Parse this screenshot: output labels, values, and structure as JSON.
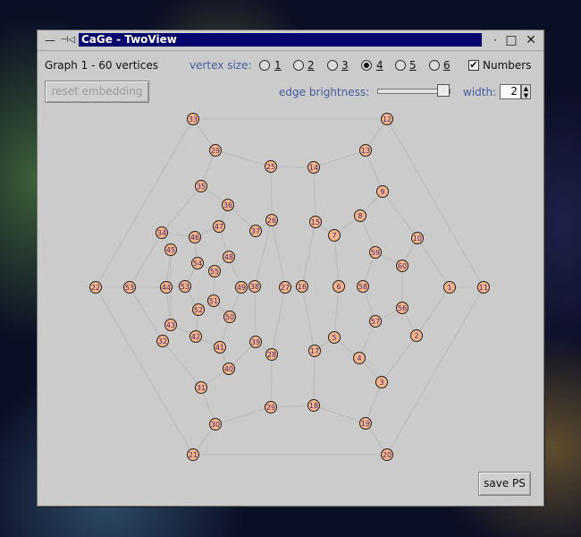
{
  "window": {
    "title": "CaGe - TwoView",
    "controls": {
      "minimize": "—",
      "pin": "⊣◁",
      "dot": "·",
      "maximize": "□",
      "close": "✕"
    }
  },
  "info": {
    "graph_label": "Graph 1 - 60 vertices"
  },
  "vertex_size": {
    "label": "vertex size:",
    "options": [
      "1",
      "2",
      "3",
      "4",
      "5",
      "6"
    ],
    "selected": "4"
  },
  "numbers": {
    "label": "Numbers",
    "checked": true,
    "check_glyph": "✔"
  },
  "reset_button": {
    "label": "reset embedding",
    "enabled": false
  },
  "edge_brightness": {
    "label": "edge brightness:",
    "level": 0.92
  },
  "width": {
    "label": "width:",
    "value": "2",
    "up": "▲",
    "down": "▼"
  },
  "save_button": {
    "label": "save PS"
  },
  "colors": {
    "vertex_fill": "#f7b489",
    "vertex_stroke": "#222222",
    "edge": "#bdbdbd",
    "label": "#3a2a7a",
    "title_bg": "#06066e"
  },
  "graph": {
    "vertices": [
      {
        "id": "33"
      },
      {
        "id": "12"
      },
      {
        "id": "29"
      },
      {
        "id": "13"
      },
      {
        "id": "25"
      },
      {
        "id": "14"
      },
      {
        "id": "35"
      },
      {
        "id": "9"
      },
      {
        "id": "36"
      },
      {
        "id": "26"
      },
      {
        "id": "15"
      },
      {
        "id": "8"
      },
      {
        "id": "47"
      },
      {
        "id": "37"
      },
      {
        "id": "7"
      },
      {
        "id": "34"
      },
      {
        "id": "46"
      },
      {
        "id": "10"
      },
      {
        "id": "45"
      },
      {
        "id": "48"
      },
      {
        "id": "59"
      },
      {
        "id": "54"
      },
      {
        "id": "60"
      },
      {
        "id": "55"
      },
      {
        "id": "22"
      },
      {
        "id": "53"
      },
      {
        "id": "44"
      },
      {
        "id": "53b",
        "label": "53"
      },
      {
        "id": "49"
      },
      {
        "id": "38"
      },
      {
        "id": "27"
      },
      {
        "id": "16"
      },
      {
        "id": "6"
      },
      {
        "id": "58"
      },
      {
        "id": "1"
      },
      {
        "id": "11"
      },
      {
        "id": "51"
      },
      {
        "id": "52"
      },
      {
        "id": "56"
      },
      {
        "id": "50"
      },
      {
        "id": "57"
      },
      {
        "id": "43"
      },
      {
        "id": "42"
      },
      {
        "id": "5"
      },
      {
        "id": "2"
      },
      {
        "id": "32"
      },
      {
        "id": "41"
      },
      {
        "id": "39"
      },
      {
        "id": "28"
      },
      {
        "id": "17"
      },
      {
        "id": "4"
      },
      {
        "id": "40"
      },
      {
        "id": "3"
      },
      {
        "id": "31"
      },
      {
        "id": "29b",
        "label": "29"
      },
      {
        "id": "18"
      },
      {
        "id": "30"
      },
      {
        "id": "19"
      },
      {
        "id": "21"
      },
      {
        "id": "20"
      }
    ],
    "edges": [
      [
        "33",
        "12"
      ],
      [
        "12",
        "11"
      ],
      [
        "11",
        "20"
      ],
      [
        "20",
        "21"
      ],
      [
        "21",
        "22"
      ],
      [
        "22",
        "33"
      ],
      [
        "33",
        "29"
      ],
      [
        "29",
        "25"
      ],
      [
        "25",
        "14"
      ],
      [
        "14",
        "13"
      ],
      [
        "13",
        "12"
      ],
      [
        "29",
        "35"
      ],
      [
        "35",
        "34"
      ],
      [
        "34",
        "45"
      ],
      [
        "45",
        "43"
      ],
      [
        "43",
        "32"
      ],
      [
        "32",
        "31"
      ],
      [
        "31",
        "30"
      ],
      [
        "30",
        "29b"
      ],
      [
        "29b",
        "18"
      ],
      [
        "18",
        "19"
      ],
      [
        "19",
        "3"
      ],
      [
        "3",
        "2"
      ],
      [
        "2",
        "1"
      ],
      [
        "1",
        "10"
      ],
      [
        "10",
        "9"
      ],
      [
        "9",
        "13"
      ],
      [
        "22",
        "53"
      ],
      [
        "53",
        "44"
      ],
      [
        "53",
        "34"
      ],
      [
        "53",
        "32"
      ],
      [
        "11",
        "1"
      ],
      [
        "21",
        "30"
      ],
      [
        "20",
        "19"
      ],
      [
        "25",
        "26"
      ],
      [
        "14",
        "15"
      ],
      [
        "26",
        "37"
      ],
      [
        "26",
        "38"
      ],
      [
        "15",
        "7"
      ],
      [
        "15",
        "16"
      ],
      [
        "35",
        "36"
      ],
      [
        "36",
        "37"
      ],
      [
        "36",
        "47"
      ],
      [
        "47",
        "46"
      ],
      [
        "46",
        "34"
      ],
      [
        "47",
        "48"
      ],
      [
        "9",
        "8"
      ],
      [
        "8",
        "7"
      ],
      [
        "8",
        "59"
      ],
      [
        "7",
        "6"
      ],
      [
        "59",
        "60"
      ],
      [
        "60",
        "10"
      ],
      [
        "60",
        "56"
      ],
      [
        "59",
        "58"
      ],
      [
        "58",
        "57"
      ],
      [
        "57",
        "56"
      ],
      [
        "56",
        "2"
      ],
      [
        "57",
        "4"
      ],
      [
        "4",
        "3"
      ],
      [
        "4",
        "5"
      ],
      [
        "5",
        "6"
      ],
      [
        "5",
        "17"
      ],
      [
        "17",
        "16"
      ],
      [
        "17",
        "18"
      ],
      [
        "16",
        "27"
      ],
      [
        "27",
        "28"
      ],
      [
        "27",
        "26"
      ],
      [
        "28",
        "29b"
      ],
      [
        "28",
        "39"
      ],
      [
        "39",
        "38"
      ],
      [
        "39",
        "40"
      ],
      [
        "40",
        "41"
      ],
      [
        "40",
        "31"
      ],
      [
        "41",
        "42"
      ],
      [
        "42",
        "43"
      ],
      [
        "41",
        "50"
      ],
      [
        "50",
        "51"
      ],
      [
        "51",
        "52"
      ],
      [
        "52",
        "42"
      ],
      [
        "51",
        "55"
      ],
      [
        "55",
        "54"
      ],
      [
        "54",
        "53b"
      ],
      [
        "53b",
        "44"
      ],
      [
        "54",
        "46"
      ],
      [
        "55",
        "48"
      ],
      [
        "48",
        "49"
      ],
      [
        "49",
        "38"
      ],
      [
        "49",
        "50"
      ],
      [
        "45",
        "44"
      ],
      [
        "44",
        "43"
      ],
      [
        "52",
        "53b"
      ]
    ]
  }
}
